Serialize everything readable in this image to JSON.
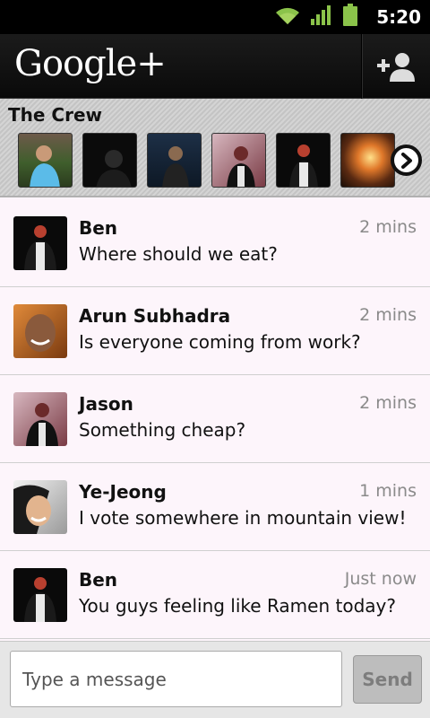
{
  "status_bar": {
    "time": "5:20",
    "icons": [
      "wifi-icon",
      "signal-icon",
      "battery-icon"
    ]
  },
  "app_bar": {
    "brand": "Google+",
    "action_icon": "add-person-icon"
  },
  "circle": {
    "title": "The Crew",
    "avatars": [
      "person-1",
      "person-2",
      "person-3",
      "person-4",
      "person-5",
      "person-6"
    ],
    "next_icon": "chevron-right-icon"
  },
  "messages": [
    {
      "name": "Ben",
      "text": "Where should we eat?",
      "time": "2 mins"
    },
    {
      "name": "Arun Subhadra",
      "text": "Is everyone coming from work?",
      "time": "2 mins"
    },
    {
      "name": "Jason",
      "text": "Something cheap?",
      "time": "2 mins"
    },
    {
      "name": "Ye-Jeong",
      "text": "I vote somewhere in mountain view!",
      "time": "1 mins"
    },
    {
      "name": "Ben",
      "text": "You guys feeling like Ramen today?",
      "time": "Just now"
    }
  ],
  "composer": {
    "placeholder": "Type a message",
    "send_label": "Send"
  },
  "colors": {
    "accent_green": "#8bc34a",
    "message_bg": "#fdf5fb",
    "time_gray": "#8a8a8a"
  }
}
